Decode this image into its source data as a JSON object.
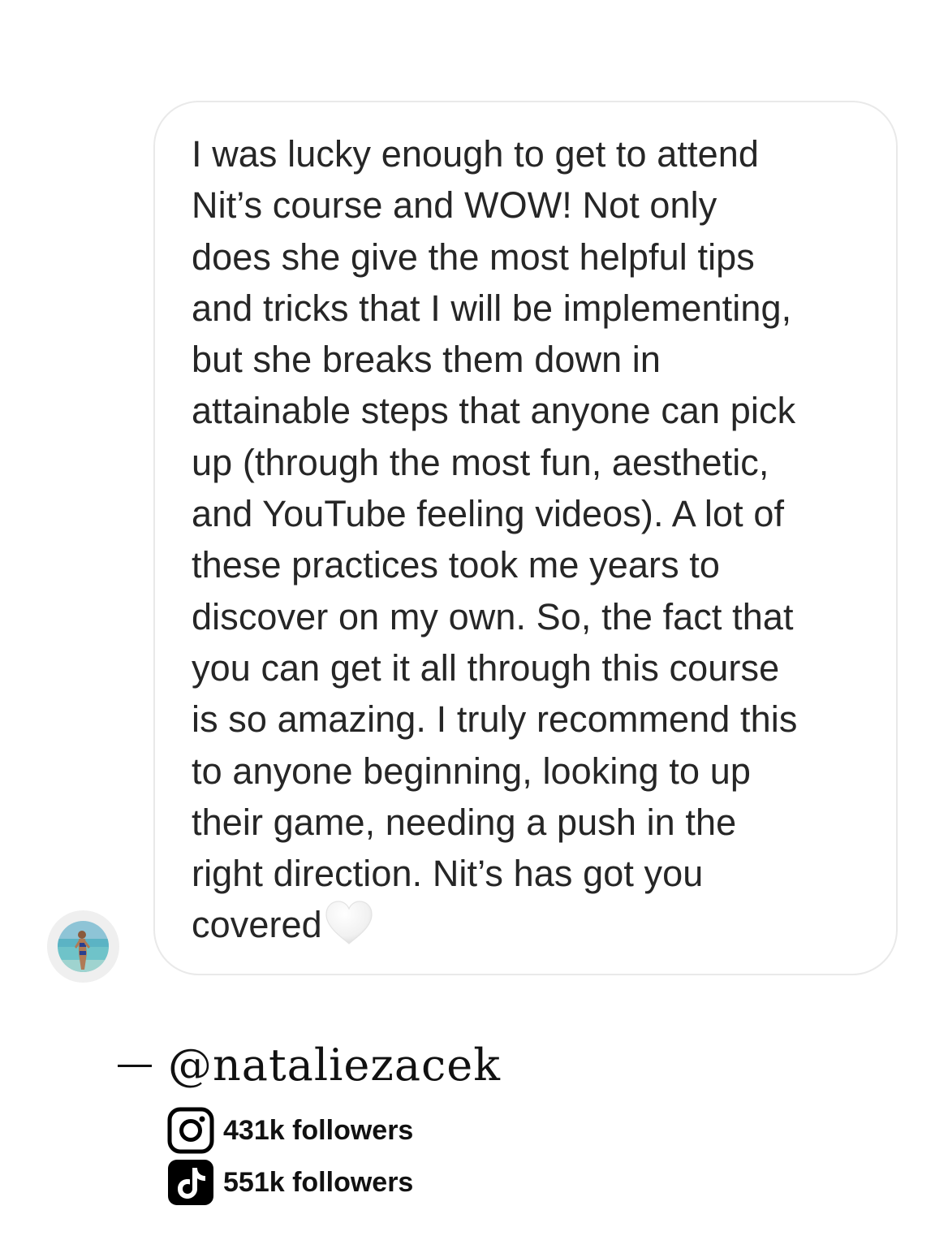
{
  "message": {
    "lines": [
      "I was lucky enough to get to attend",
      "Nit’s course and WOW! Not only",
      "does she give the most helpful tips",
      "and tricks that I will be implementing,",
      "but she breaks them down in",
      "attainable steps that anyone can pick",
      "up (through the most fun, aesthetic,",
      "and YouTube feeling videos). A lot of",
      "these practices took me years to",
      "discover on my own. So, the fact that",
      "you can get it all through this course",
      "is so amazing. I truly recommend this",
      "to anyone beginning, looking to up",
      "their game, needing a push in the",
      "right direction. Nit’s has got you",
      "covered"
    ],
    "trailing_emoji": "white-heart-icon",
    "text_color": "#262626",
    "bubble_border_color": "#e9e9e9"
  },
  "sender": {
    "avatar": "profile-avatar"
  },
  "attribution": {
    "handle": "@nataliezacek"
  },
  "stats": [
    {
      "icon": "instagram-icon",
      "text": "431k followers"
    },
    {
      "icon": "tiktok-icon",
      "text": "551k followers"
    }
  ]
}
